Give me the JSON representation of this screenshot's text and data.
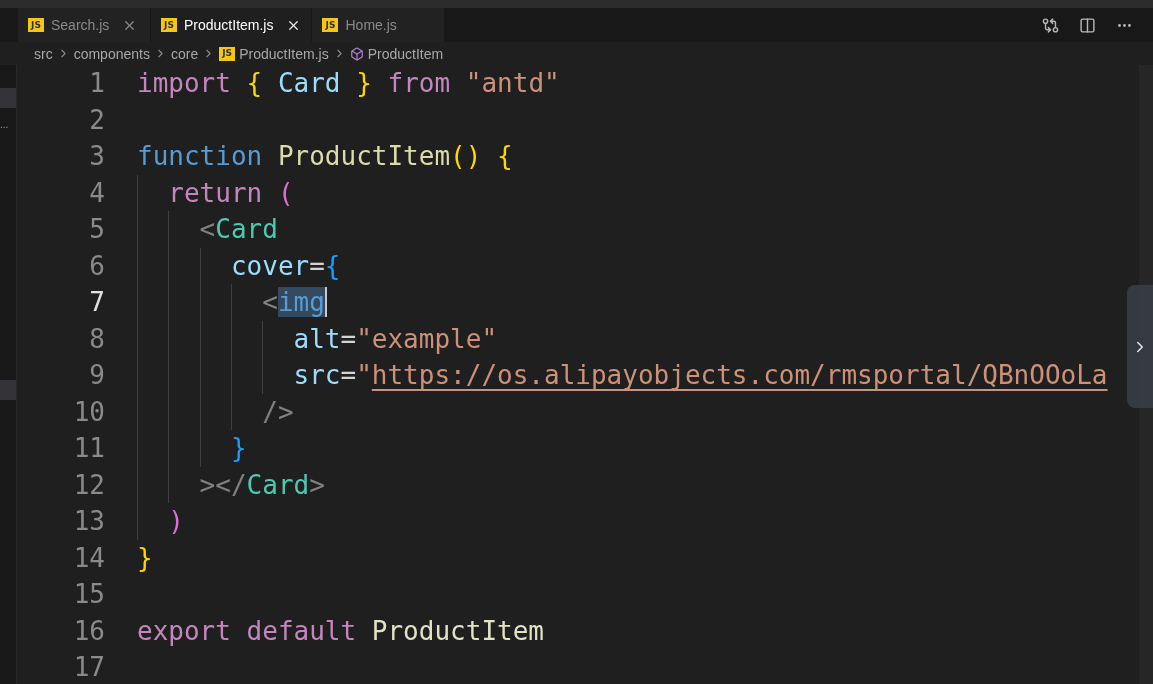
{
  "tabs": [
    {
      "label": "Search.js",
      "file_icon": "JS",
      "selected": false,
      "close_visible": true
    },
    {
      "label": "ProductItem.js",
      "file_icon": "JS",
      "selected": true,
      "close_visible": true
    },
    {
      "label": "Home.js",
      "file_icon": "JS",
      "selected": false,
      "close_visible": false
    }
  ],
  "breadcrumb": [
    {
      "label": "src",
      "kind": "folder"
    },
    {
      "label": "components",
      "kind": "folder"
    },
    {
      "label": "core",
      "kind": "folder"
    },
    {
      "label": "ProductItem.js",
      "kind": "file",
      "file_icon": "JS"
    },
    {
      "label": "ProductItem",
      "kind": "symbol"
    }
  ],
  "sidebar_edge": {
    "text": "..."
  },
  "lines": [
    {
      "number": "1",
      "current": false,
      "tokens": [
        {
          "text": "import ",
          "kind": "keyword"
        },
        {
          "text": "{ ",
          "kind": "brace"
        },
        {
          "text": "Card ",
          "kind": "variable"
        },
        {
          "text": "} ",
          "kind": "brace"
        },
        {
          "text": "from ",
          "kind": "keyword"
        },
        {
          "text": "\"antd\"",
          "kind": "string"
        }
      ]
    },
    {
      "number": "2",
      "current": false
    },
    {
      "number": "3",
      "current": false,
      "tokens": [
        {
          "text": "function ",
          "kind": "storage"
        },
        {
          "text": "ProductItem",
          "kind": "function"
        },
        {
          "text": "() {",
          "kind": "brace"
        }
      ]
    },
    {
      "number": "4",
      "current": false,
      "tokens": [
        {
          "text": "  return ",
          "kind": "keyword"
        },
        {
          "text": "(",
          "kind": "paren"
        }
      ]
    },
    {
      "number": "5",
      "current": false,
      "tokens": [
        {
          "text": "    <",
          "kind": "punct"
        },
        {
          "text": "Card",
          "kind": "component"
        }
      ]
    },
    {
      "number": "6",
      "current": false,
      "tokens": [
        {
          "text": "      cover",
          "kind": "variable"
        },
        {
          "text": "=",
          "kind": "plain"
        },
        {
          "text": "{",
          "kind": "bluebrace"
        }
      ]
    },
    {
      "number": "7",
      "current": true,
      "tokens": [
        {
          "text": "        <",
          "kind": "punct"
        },
        {
          "text": "img",
          "kind": "selection"
        }
      ]
    },
    {
      "number": "8",
      "current": false,
      "tokens": [
        {
          "text": "          alt",
          "kind": "variable"
        },
        {
          "text": "=",
          "kind": "plain"
        },
        {
          "text": "\"example\"",
          "kind": "string"
        }
      ]
    },
    {
      "number": "9",
      "current": false,
      "tokens": [
        {
          "text": "          src",
          "kind": "variable"
        },
        {
          "text": "=",
          "kind": "plain"
        },
        {
          "text": "\"",
          "kind": "string"
        },
        {
          "text": "https://os.alipayobjects.com/rmsportal/QBnOOoLa",
          "kind": "link"
        }
      ]
    },
    {
      "number": "10",
      "current": false,
      "tokens": [
        {
          "text": "        />",
          "kind": "punct"
        }
      ]
    },
    {
      "number": "11",
      "current": false,
      "tokens": [
        {
          "text": "      }",
          "kind": "bluebrace"
        }
      ]
    },
    {
      "number": "12",
      "current": false,
      "tokens": [
        {
          "text": "    ></",
          "kind": "punct"
        },
        {
          "text": "Card",
          "kind": "component"
        },
        {
          "text": ">",
          "kind": "punct"
        }
      ]
    },
    {
      "number": "13",
      "current": false,
      "tokens": [
        {
          "text": "  )",
          "kind": "paren"
        }
      ]
    },
    {
      "number": "14",
      "current": false,
      "tokens": [
        {
          "text": "}",
          "kind": "brace"
        }
      ]
    },
    {
      "number": "15",
      "current": false
    },
    {
      "number": "16",
      "current": false,
      "tokens": [
        {
          "text": "export ",
          "kind": "keyword"
        },
        {
          "text": "default ",
          "kind": "keyword"
        },
        {
          "text": "ProductItem",
          "kind": "identifier"
        }
      ]
    },
    {
      "number": "17",
      "current": false
    }
  ]
}
